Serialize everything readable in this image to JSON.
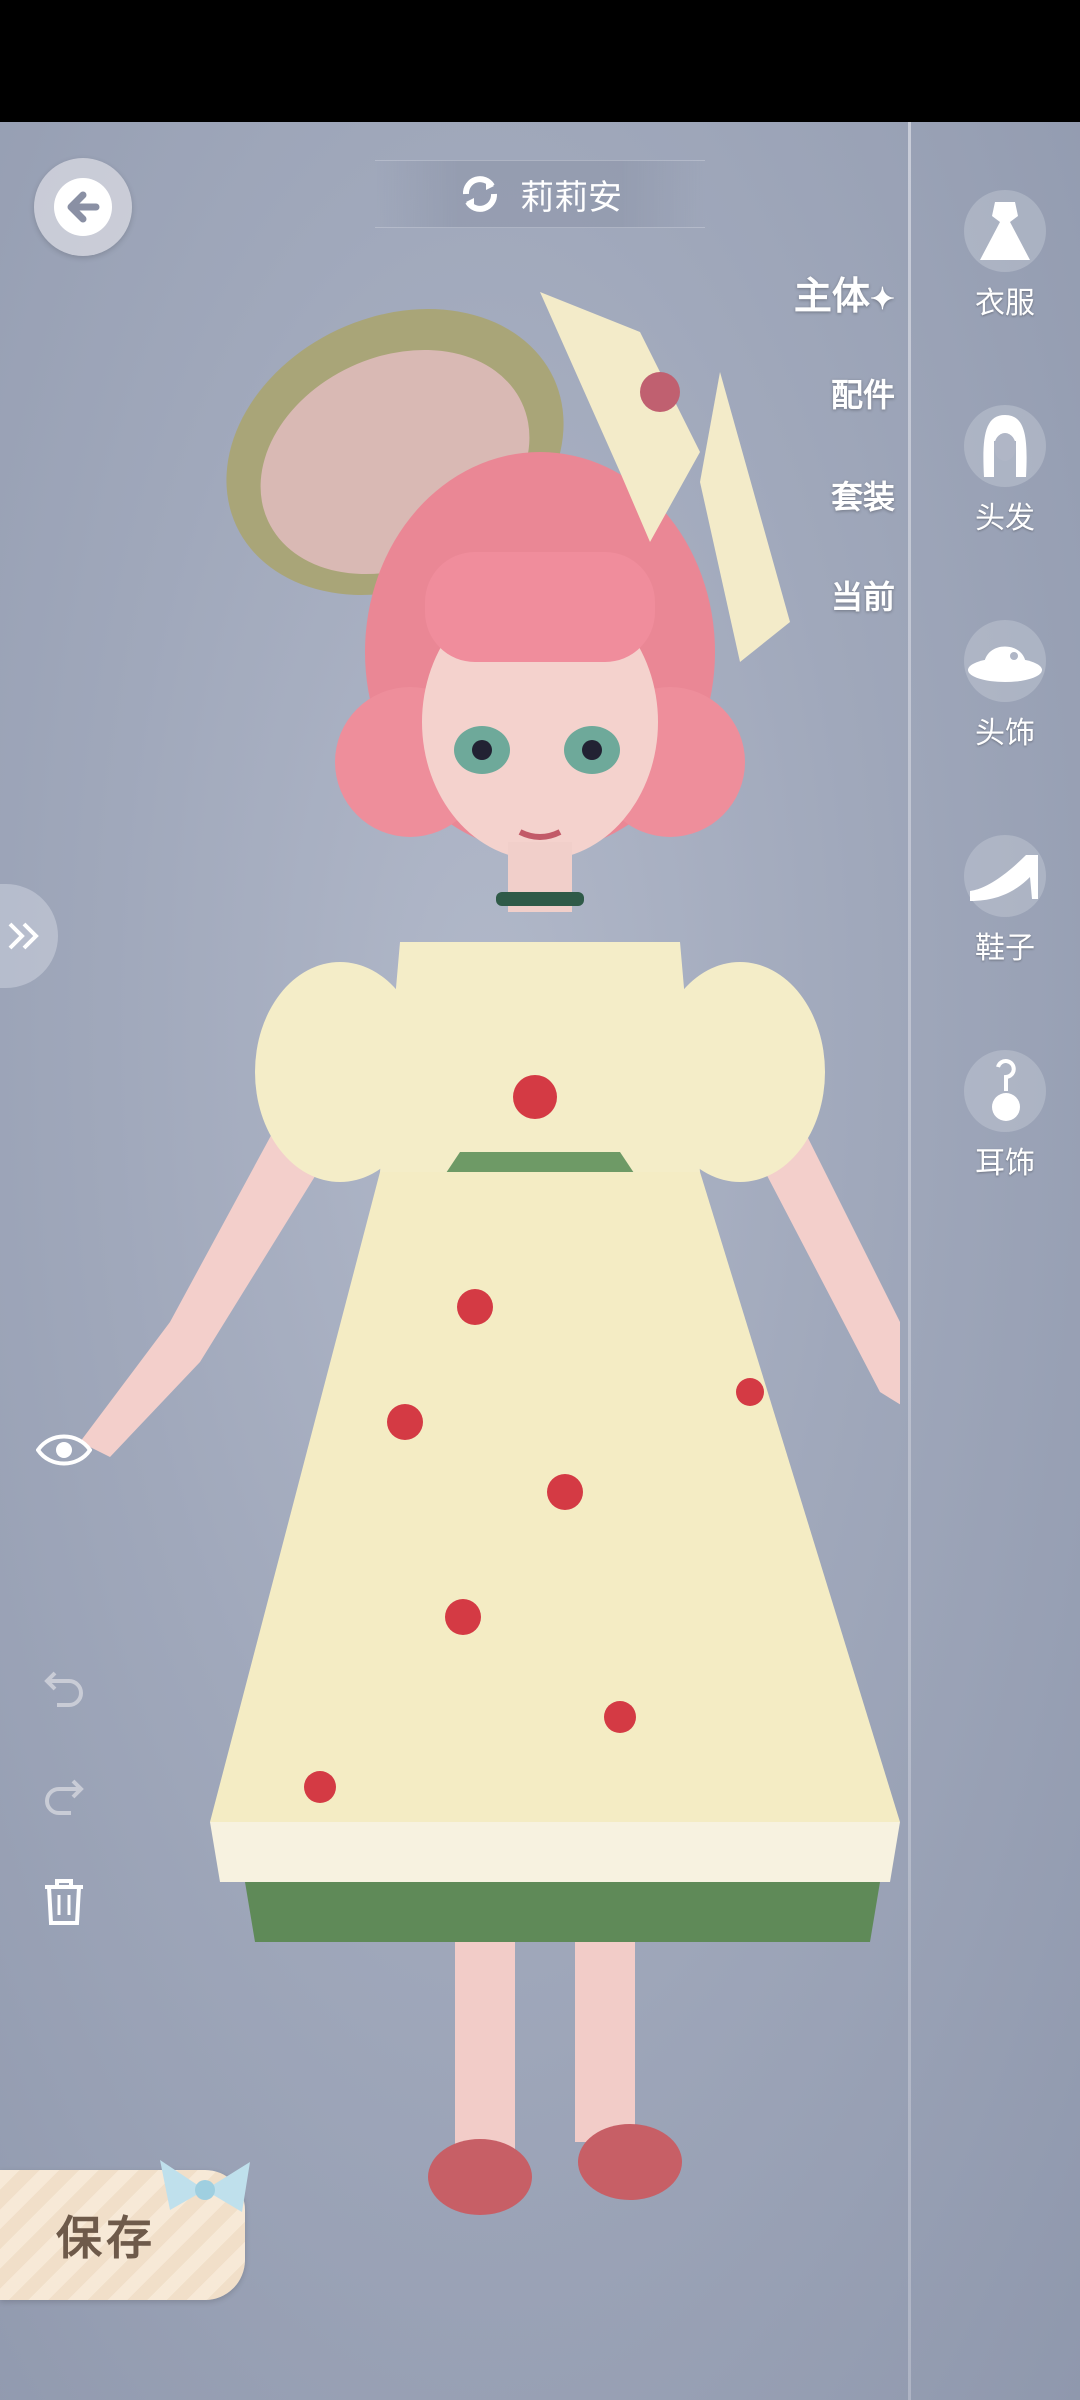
{
  "character": {
    "name": "莉莉安"
  },
  "tabs": [
    {
      "label": "主体",
      "active": true
    },
    {
      "label": "配件",
      "active": false
    },
    {
      "label": "套装",
      "active": false
    },
    {
      "label": "当前",
      "active": false
    }
  ],
  "categories": [
    {
      "label": "衣服",
      "icon": "dress-icon"
    },
    {
      "label": "头发",
      "icon": "hair-icon"
    },
    {
      "label": "头饰",
      "icon": "hat-icon"
    },
    {
      "label": "鞋子",
      "icon": "shoe-icon"
    },
    {
      "label": "耳饰",
      "icon": "earring-icon"
    }
  ],
  "toolbar": {
    "save_label": "保存"
  },
  "colors": {
    "accent": "#ffffff",
    "save_text": "#6e5a4a",
    "dress": "#f4ecc4",
    "hair": "#f08d9c",
    "skirt_trim": "#5f8a58"
  }
}
